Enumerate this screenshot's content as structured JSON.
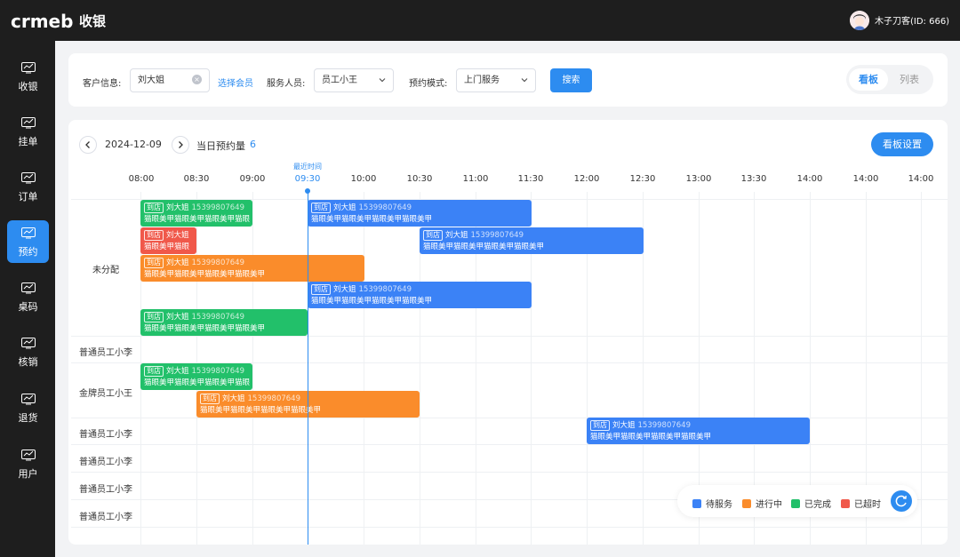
{
  "app": {
    "logo": "crmeb",
    "title": "收银"
  },
  "user": {
    "name": "木子刀客(ID: 666)"
  },
  "sidebar": {
    "items": [
      {
        "label": "收银"
      },
      {
        "label": "挂单"
      },
      {
        "label": "订单"
      },
      {
        "label": "预约"
      },
      {
        "label": "桌码"
      },
      {
        "label": "核销"
      },
      {
        "label": "退货"
      },
      {
        "label": "用户"
      }
    ],
    "active": "预约"
  },
  "filters": {
    "customer_label": "客户信息:",
    "customer_value": "刘大姐",
    "choose_member": "选择会员",
    "staff_label": "服务人员:",
    "staff_value": "员工小王",
    "mode_label": "预约模式:",
    "mode_value": "上门服务",
    "search_label": "搜索"
  },
  "view": {
    "board": "看板",
    "list": "列表",
    "active": "看板"
  },
  "board": {
    "date": "2024-12-09",
    "count_label": "当日预约量",
    "count": "6",
    "settings_label": "看板设置",
    "now_caption": "最近时间"
  },
  "timeline": [
    "08:00",
    "08:30",
    "09:00",
    "09:30",
    "10:00",
    "10:30",
    "11:00",
    "11:30",
    "12:00",
    "12:30",
    "13:00",
    "13:30",
    "14:00",
    "14:00",
    "14:00"
  ],
  "employees": [
    "未分配",
    "普通员工小李",
    "金牌员工小王",
    "普通员工小李",
    "普通员工小李",
    "普通员工小李",
    "普通员工小李"
  ],
  "appointments": [
    {
      "tag": "到店",
      "name": "刘大姐",
      "phone": "15399807649",
      "service": "猫眼美甲猫眼美甲猫眼美甲猫眼",
      "status": "已完成"
    },
    {
      "tag": "到店",
      "name": "刘大姐",
      "phone": "15399807649",
      "service": "猫眼美甲猫眼美甲猫眼美甲猫眼美甲",
      "status": "待服务"
    },
    {
      "tag": "到店",
      "name": "刘大姐",
      "phone": "",
      "service": "猫眼美甲猫眼",
      "status": "已超时"
    },
    {
      "tag": "到店",
      "name": "刘大姐",
      "phone": "15399807649",
      "service": "猫眼美甲猫眼美甲猫眼美甲猫眼美甲",
      "status": "待服务"
    },
    {
      "tag": "到店",
      "name": "刘大姐",
      "phone": "15399807649",
      "service": "猫眼美甲猫眼美甲猫眼美甲猫眼美甲",
      "status": "进行中"
    },
    {
      "tag": "到店",
      "name": "刘大姐",
      "phone": "15399807649",
      "service": "猫眼美甲猫眼美甲猫眼美甲猫眼美甲",
      "status": "待服务"
    },
    {
      "tag": "到店",
      "name": "刘大姐",
      "phone": "15399807649",
      "service": "猫眼美甲猫眼美甲猫眼美甲猫眼美甲",
      "status": "已完成"
    },
    {
      "tag": "到店",
      "name": "刘大姐",
      "phone": "15399807649",
      "service": "猫眼美甲猫眼美甲猫眼美甲猫眼",
      "status": "已完成"
    },
    {
      "tag": "到店",
      "name": "刘大姐",
      "phone": "15399807649",
      "service": "猫眼美甲猫眼美甲猫眼美甲猫眼美甲",
      "status": "进行中"
    },
    {
      "tag": "到店",
      "name": "刘大姐",
      "phone": "15399807649",
      "service": "猫眼美甲猫眼美甲猫眼美甲猫眼美甲",
      "status": "待服务"
    }
  ],
  "legend": [
    {
      "label": "待服务",
      "color": "#3b82f6"
    },
    {
      "label": "进行中",
      "color": "#fa8c2b"
    },
    {
      "label": "已完成",
      "color": "#22c06a"
    },
    {
      "label": "已超时",
      "color": "#f0584a"
    }
  ],
  "colors": {
    "accent": "#2d8cf0",
    "pending": "#3b82f6",
    "in_progress": "#fa8c2b",
    "done": "#22c06a",
    "overtime": "#f0584a"
  }
}
